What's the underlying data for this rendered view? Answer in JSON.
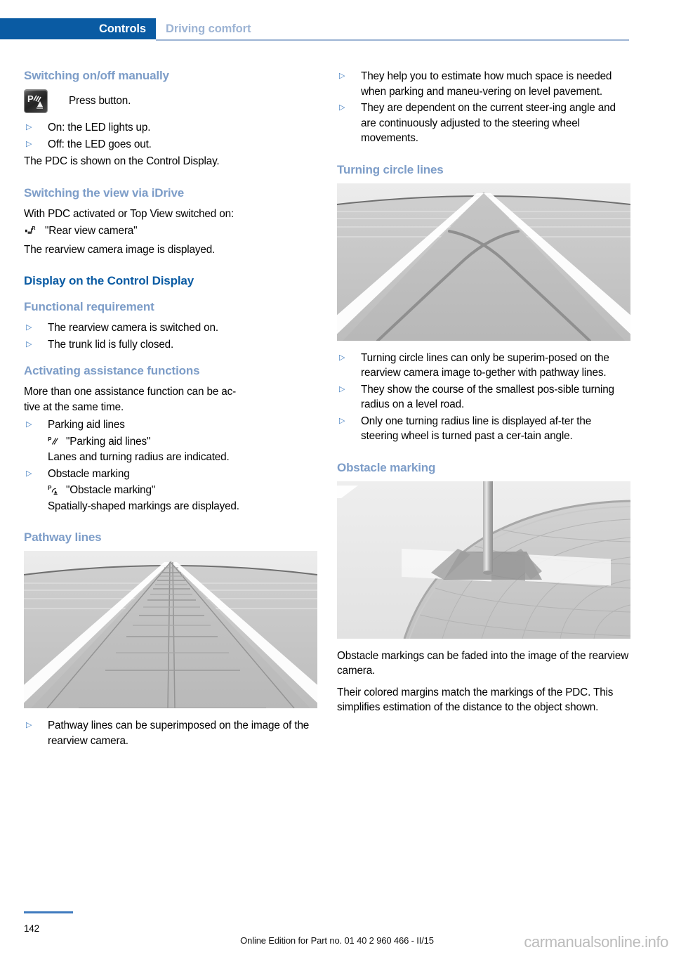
{
  "header": {
    "active_tab": "Controls",
    "inactive_tab": "Driving comfort",
    "active_color": "#0a5ba3",
    "inactive_color": "#9db4d4"
  },
  "left_column": {
    "heading_switching": "Switching on/off manually",
    "press_button_label": "Press button.",
    "pdc_button_icon": "pdc-button-icon",
    "bullets_led": [
      "On: the LED lights up.",
      "Off: the LED goes out."
    ],
    "pdc_shown_text": "The PDC is shown on the Control Display.",
    "heading_idrive": "Switching the view via iDrive",
    "idrive_intro": "With PDC activated or Top View switched on:",
    "rear_view_camera_icon": "rear-view-camera-icon",
    "rear_view_camera_label": "\"Rear view camera\"",
    "rear_view_result": "The rearview camera image is displayed.",
    "heading_display_control": "Display on the Control Display",
    "heading_functional_requirement": "Functional requirement",
    "bullets_functional": [
      "The rearview camera is switched on.",
      "The trunk lid is fully closed."
    ],
    "heading_activating": "Activating assistance functions",
    "activating_intro": "More than one assistance function can be ac-\ntive at the same time.",
    "bullet_parking_aid": "Parking aid lines",
    "parking_aid_icon": "parking-aid-lines-icon",
    "parking_aid_quoted": "\"Parking aid lines\"",
    "parking_aid_desc": "Lanes and turning radius are indicated.",
    "bullet_obstacle": "Obstacle marking",
    "obstacle_icon": "obstacle-marking-icon",
    "obstacle_quoted": "\"Obstacle marking\"",
    "obstacle_desc": "Spatially-shaped markings are displayed.",
    "heading_pathway": "Pathway lines",
    "figure_pathway_alt": "pathway-lines-figure",
    "bullet_pathway": "Pathway lines can be superimposed on the image of the rearview camera."
  },
  "right_column": {
    "bullets_top": [
      "They help you to estimate how much space is needed when parking and maneu-vering on level pavement.",
      "They are dependent on the current steer-ing angle and are continuously adjusted to the steering wheel movements."
    ],
    "heading_turning_circle": "Turning circle lines",
    "figure_turning_alt": "turning-circle-lines-figure",
    "bullets_turning": [
      "Turning circle lines can only be superim-posed on the rearview camera image to-gether with pathway lines.",
      "They show the course of the smallest pos-sible turning radius on a level road.",
      "Only one turning radius line is displayed af-ter the steering wheel is turned past a cer-tain angle."
    ],
    "heading_obstacle": "Obstacle marking",
    "figure_obstacle_alt": "obstacle-marking-figure",
    "paragraph_1": "Obstacle markings can be faded into the image of the rearview camera.",
    "paragraph_2": "Their colored margins match the markings of the PDC. This simplifies estimation of the distance to the object shown."
  },
  "footer": {
    "page_number": "142",
    "edition_text": "Online Edition for Part no. 01 40 2 960 466 - II/15",
    "watermark": "carmanualsonline.info"
  },
  "bullet_glyph": "▷"
}
